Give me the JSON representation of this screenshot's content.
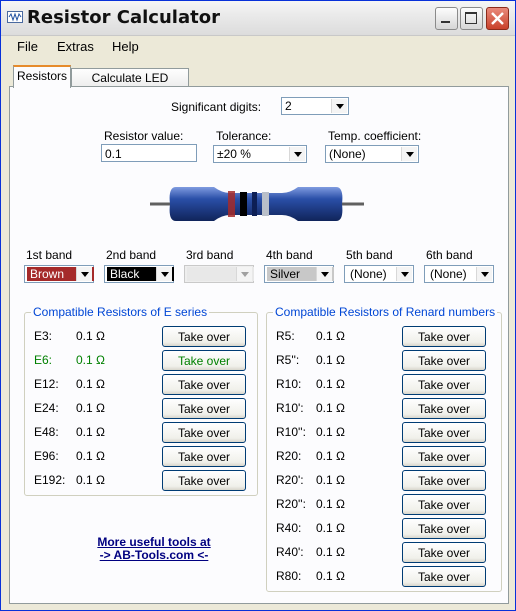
{
  "window": {
    "title": "Resistor Calculator"
  },
  "menu": [
    "File",
    "Extras",
    "Help"
  ],
  "tabs": [
    {
      "label": "Resistors",
      "active": true
    },
    {
      "label": "Calculate LED resistors",
      "active": false
    }
  ],
  "settings": {
    "significant_digits_label": "Significant digits:",
    "significant_digits_value": "2",
    "resistor_value_label": "Resistor value:",
    "resistor_value": "0.1",
    "tolerance_label": "Tolerance:",
    "tolerance_value": "±20 %",
    "temp_coeff_label": "Temp. coefficient:",
    "temp_coeff_value": "(None)"
  },
  "bands": [
    {
      "label": "1st band",
      "value": "Brown",
      "swatch": "#a52a2a",
      "text_color": "#ffffff"
    },
    {
      "label": "2nd band",
      "value": "Black",
      "swatch": "#000000",
      "text_color": "#ffffff"
    },
    {
      "label": "3rd band",
      "value": "",
      "swatch": "#e8e8e8",
      "text_color": "#000000"
    },
    {
      "label": "4th band",
      "value": "Silver",
      "swatch": "#c8c8c8",
      "text_color": "#000000"
    },
    {
      "label": "5th band",
      "value": "(None)",
      "swatch": "#ffffff",
      "text_color": "#000000"
    },
    {
      "label": "6th band",
      "value": "(None)",
      "swatch": "#ffffff",
      "text_color": "#000000"
    }
  ],
  "e_series": {
    "title": "Compatible Resistors of E series",
    "button_label": "Take over",
    "rows": [
      {
        "name": "E3:",
        "value": "0.1 Ω",
        "highlight": false
      },
      {
        "name": "E6:",
        "value": "0.1 Ω",
        "highlight": true
      },
      {
        "name": "E12:",
        "value": "0.1 Ω",
        "highlight": false
      },
      {
        "name": "E24:",
        "value": "0.1 Ω",
        "highlight": false
      },
      {
        "name": "E48:",
        "value": "0.1 Ω",
        "highlight": false
      },
      {
        "name": "E96:",
        "value": "0.1 Ω",
        "highlight": false
      },
      {
        "name": "E192:",
        "value": "0.1 Ω",
        "highlight": false
      }
    ]
  },
  "renard": {
    "title": "Compatible Resistors of Renard numbers",
    "button_label": "Take over",
    "rows": [
      {
        "name": "R5:",
        "value": "0.1 Ω"
      },
      {
        "name": "R5'':",
        "value": "0.1 Ω"
      },
      {
        "name": "R10:",
        "value": "0.1 Ω"
      },
      {
        "name": "R10':",
        "value": "0.1 Ω"
      },
      {
        "name": "R10'':",
        "value": "0.1 Ω"
      },
      {
        "name": "R20:",
        "value": "0.1 Ω"
      },
      {
        "name": "R20':",
        "value": "0.1 Ω"
      },
      {
        "name": "R20'':",
        "value": "0.1 Ω"
      },
      {
        "name": "R40:",
        "value": "0.1 Ω"
      },
      {
        "name": "R40':",
        "value": "0.1 Ω"
      },
      {
        "name": "R80:",
        "value": "0.1 Ω"
      }
    ]
  },
  "footer_link": {
    "line1": "More useful tools at",
    "line2": "-> AB-Tools.com <-"
  },
  "colors": {
    "highlight_green": "#008000",
    "group_title_blue": "#0046d5",
    "link_navy": "#000080",
    "resistor_body": "#2a4fa8"
  }
}
